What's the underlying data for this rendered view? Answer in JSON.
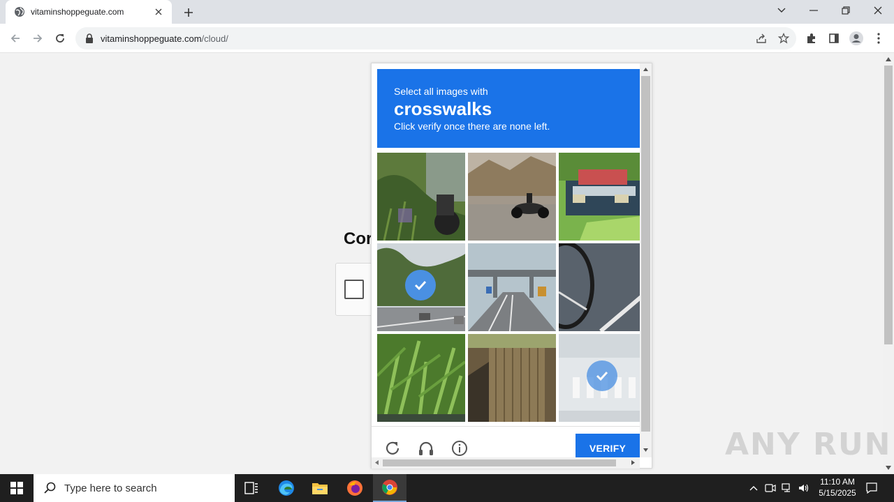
{
  "browser": {
    "tab_title": "vitaminshoppeguate.com",
    "url_domain": "vitaminshoppeguate.com",
    "url_path": "/cloud/"
  },
  "page": {
    "heading_partial": "Cor"
  },
  "captcha": {
    "subtitle": "Select all images with",
    "target": "crosswalks",
    "instruction": "Click verify once there are none left.",
    "verify_label": "VERIFY",
    "tiles": [
      {
        "scene": "plants and motorcycle",
        "selected": false
      },
      {
        "scene": "motorcycle on road",
        "selected": false
      },
      {
        "scene": "truck near trees",
        "selected": false
      },
      {
        "scene": "street with trees",
        "selected": true
      },
      {
        "scene": "highway overpass",
        "selected": false
      },
      {
        "scene": "bicycle wheel on asphalt",
        "selected": false
      },
      {
        "scene": "green plants",
        "selected": false
      },
      {
        "scene": "wooden shed",
        "selected": false
      },
      {
        "scene": "crosswalk fading",
        "selected": true
      }
    ],
    "header_color": "#1a73e8"
  },
  "watermark": "ANY RUN",
  "taskbar": {
    "search_placeholder": "Type here to search",
    "time": "11:10 AM",
    "date": "5/15/2025"
  }
}
